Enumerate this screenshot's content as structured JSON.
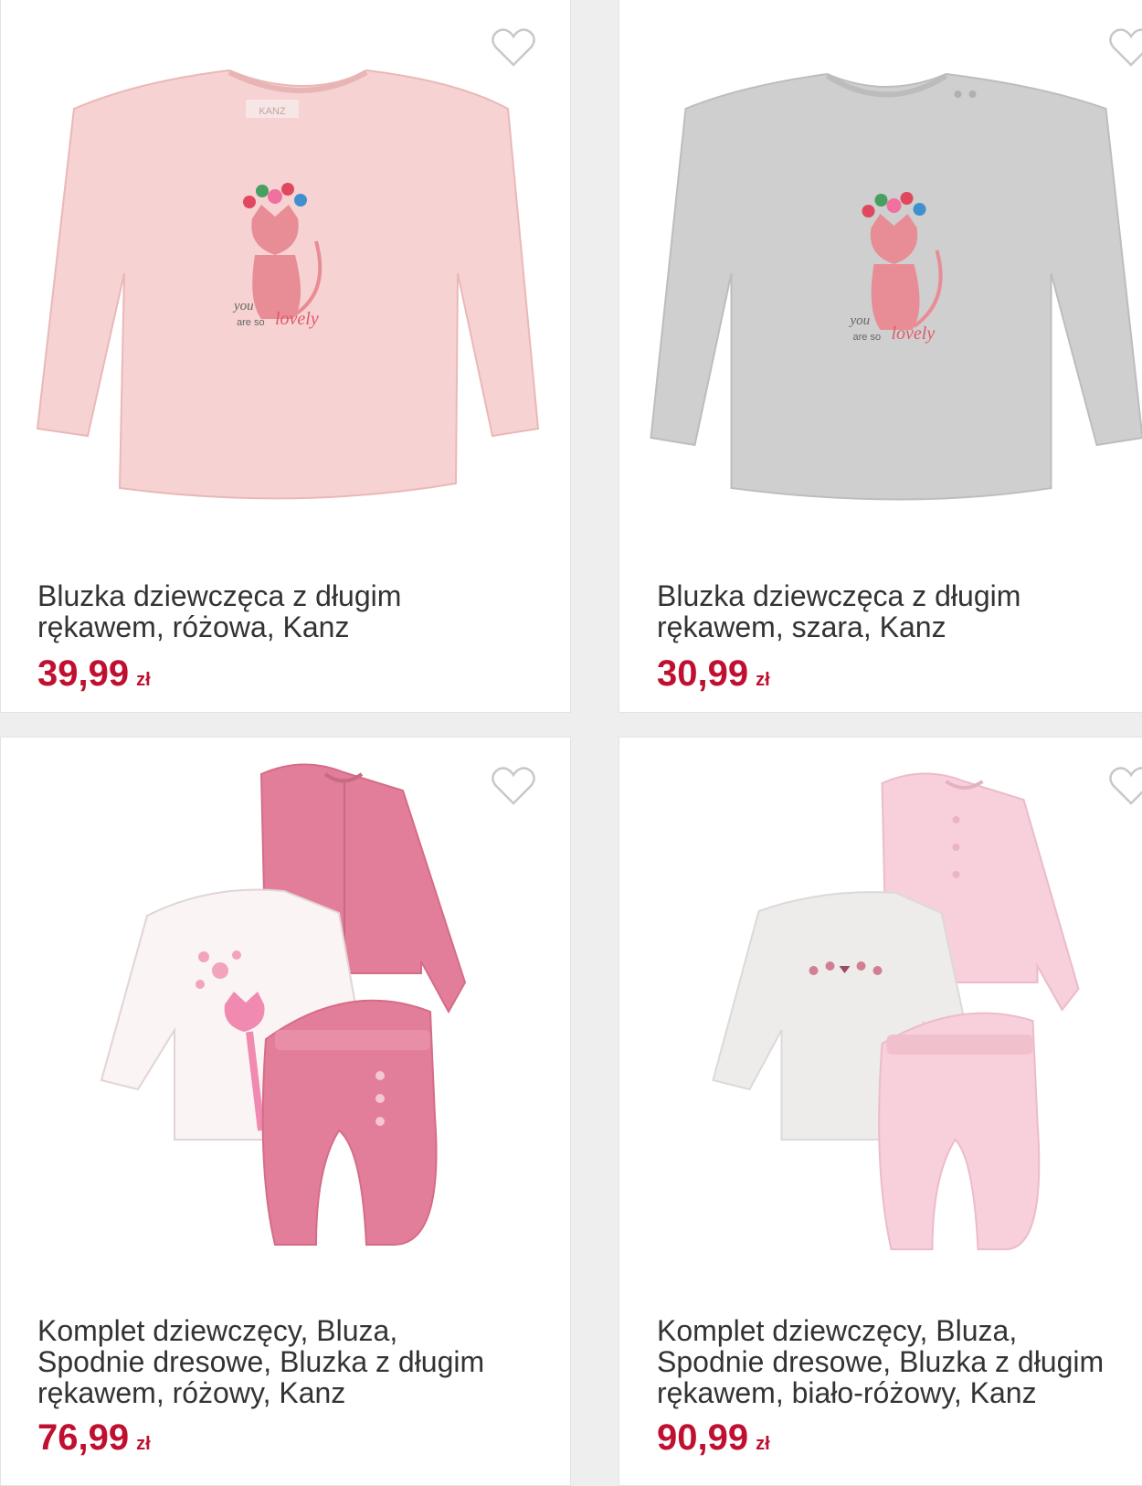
{
  "products": [
    {
      "title": "Bluzka dziewczęca z długim rękawem, różowa, Kanz",
      "price": "39,99",
      "currency": "zł",
      "image_label_brand": "KANZ",
      "print_text_1": "you",
      "print_text_2": "are so",
      "print_text_3": "lovely"
    },
    {
      "title": "Bluzka dziewczęca z długim rękawem, szara, Kanz",
      "price": "30,99",
      "currency": "zł",
      "print_text_1": "you",
      "print_text_2": "are so",
      "print_text_3": "lovely"
    },
    {
      "title": "Komplet dziewczęcy, Bluza, Spodnie dresowe, Bluzka z długim rękawem, różowy, Kanz",
      "price": "76,99",
      "currency": "zł"
    },
    {
      "title": "Komplet dziewczęcy, Bluza, Spodnie dresowe, Bluzka z długim rękawem, biało-różowy, Kanz",
      "price": "90,99",
      "currency": "zł"
    }
  ],
  "icons": {
    "wishlist": "heart-outline-icon"
  },
  "colors": {
    "price": "#c01030",
    "text": "#333333",
    "background": "#eeeeee",
    "card": "#ffffff"
  }
}
